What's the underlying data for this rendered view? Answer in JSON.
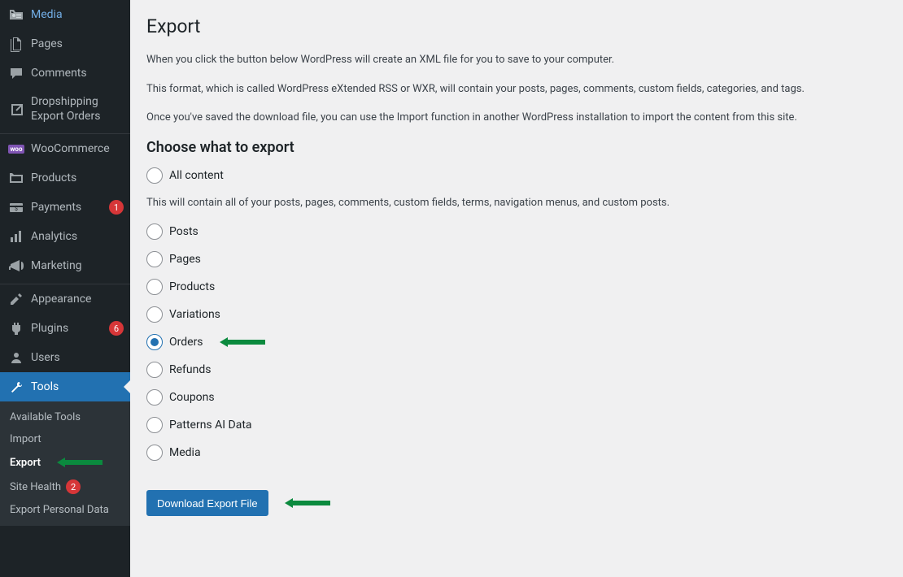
{
  "sidebar": {
    "items": [
      {
        "label": "Media"
      },
      {
        "label": "Pages"
      },
      {
        "label": "Comments"
      },
      {
        "label": "Dropshipping Export Orders"
      },
      {
        "label": "WooCommerce"
      },
      {
        "label": "Products"
      },
      {
        "label": "Payments",
        "badge": "1"
      },
      {
        "label": "Analytics"
      },
      {
        "label": "Marketing"
      },
      {
        "label": "Appearance"
      },
      {
        "label": "Plugins",
        "badge": "6"
      },
      {
        "label": "Users"
      },
      {
        "label": "Tools"
      }
    ],
    "submenu": [
      {
        "label": "Available Tools"
      },
      {
        "label": "Import"
      },
      {
        "label": "Export"
      },
      {
        "label": "Site Health",
        "badge": "2"
      },
      {
        "label": "Export Personal Data"
      }
    ]
  },
  "page": {
    "title": "Export",
    "intro1": "When you click the button below WordPress will create an XML file for you to save to your computer.",
    "intro2": "This format, which is called WordPress eXtended RSS or WXR, will contain your posts, pages, comments, custom fields, categories, and tags.",
    "intro3": "Once you've saved the download file, you can use the Import function in another WordPress installation to import the content from this site.",
    "section_title": "Choose what to export",
    "all_content_desc": "This will contain all of your posts, pages, comments, custom fields, terms, navigation menus, and custom posts.",
    "options": [
      {
        "label": "All content"
      },
      {
        "label": "Posts"
      },
      {
        "label": "Pages"
      },
      {
        "label": "Products"
      },
      {
        "label": "Variations"
      },
      {
        "label": "Orders",
        "checked": true
      },
      {
        "label": "Refunds"
      },
      {
        "label": "Coupons"
      },
      {
        "label": "Patterns AI Data"
      },
      {
        "label": "Media"
      }
    ],
    "download_button": "Download Export File"
  }
}
